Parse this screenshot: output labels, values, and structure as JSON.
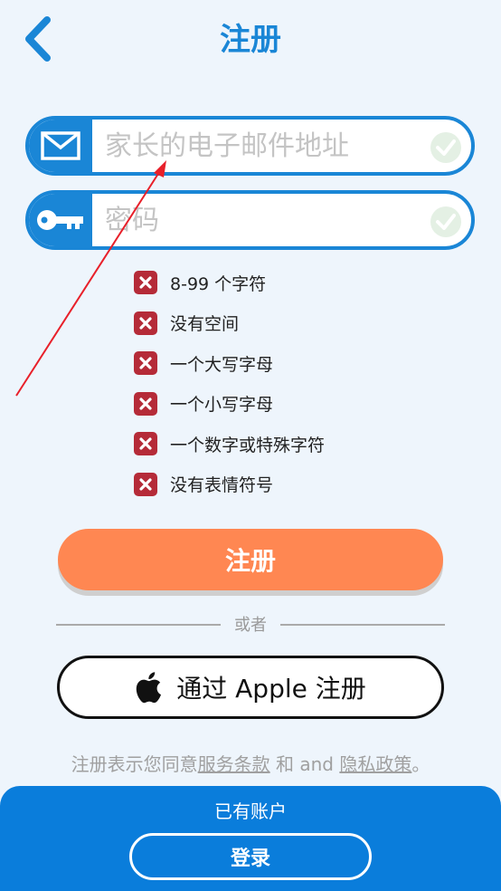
{
  "header": {
    "title": "注册"
  },
  "form": {
    "email_placeholder": "家长的电子邮件地址",
    "password_placeholder": "密码"
  },
  "rules": [
    {
      "text": "8-99 个字符",
      "status": "failed"
    },
    {
      "text": "没有空间",
      "status": "failed"
    },
    {
      "text": "一个大写字母",
      "status": "failed"
    },
    {
      "text": "一个小写字母",
      "status": "failed"
    },
    {
      "text": "一个数字或特殊字符",
      "status": "failed"
    },
    {
      "text": "没有表情符号",
      "status": "failed"
    }
  ],
  "actions": {
    "signup_label": "注册",
    "or_label": "或者",
    "apple_label": "通过 Apple 注册"
  },
  "terms": {
    "prefix": "注册表示您同意",
    "terms_link": "服务条款",
    "middle": " 和 and ",
    "privacy_link": "隐私政策",
    "suffix": "。"
  },
  "footer": {
    "have_account": "已有账户",
    "login_label": "登录"
  },
  "colors": {
    "primary": "#1a86d6",
    "signup": "#ff8752",
    "error": "#b52b38",
    "footer": "#0a7ddb",
    "background": "#eef5fc"
  }
}
